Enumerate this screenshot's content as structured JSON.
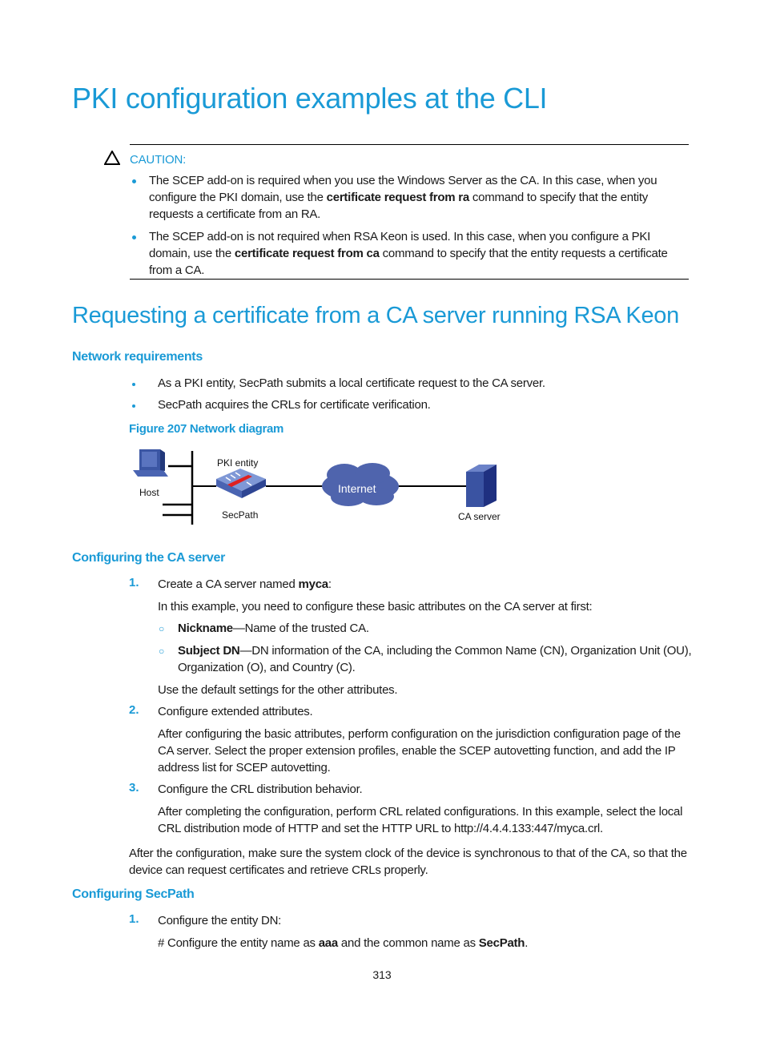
{
  "page": {
    "title": "PKI configuration examples at the CLI",
    "page_number": "313"
  },
  "caution": {
    "icon": "warning-triangle-icon",
    "label": "CAUTION:",
    "items": [
      {
        "pre": "The SCEP add-on is required when you use the Windows Server as the CA. In this case, when you configure the PKI domain, use the ",
        "bold": "certificate request from ra",
        "post": " command to specify that the entity requests a certificate from an RA."
      },
      {
        "pre": "The SCEP add-on is not required when RSA Keon is used. In this case, when you configure a PKI domain, use the ",
        "bold": "certificate request from ca",
        "post": " command to specify that the entity requests a certificate from a CA."
      }
    ]
  },
  "section": {
    "title": "Requesting a certificate from a CA server running RSA Keon",
    "network_requirements": {
      "heading": "Network requirements",
      "bullets": [
        "As a PKI entity, SecPath submits a local certificate request to the CA server.",
        "SecPath acquires the CRLs for certificate verification."
      ],
      "figure_caption": "Figure 207 Network diagram",
      "diagram": {
        "host_label": "Host",
        "pki_entity_label": "PKI entity",
        "secpath_label": "SecPath",
        "internet_label": "Internet",
        "ca_server_label": "CA server"
      }
    },
    "configuring_ca": {
      "heading": "Configuring the CA server",
      "steps": [
        {
          "num": "1.",
          "text_pre": "Create a CA server named ",
          "text_bold": "myca",
          "text_post": ":",
          "body": "In this example, you need to configure these basic attributes on the CA server at first:",
          "sub": [
            {
              "bold": "Nickname",
              "text": "—Name of the trusted CA."
            },
            {
              "bold": "Subject DN",
              "text": "—DN information of the CA, including the Common Name (CN), Organization Unit (OU), Organization (O), and Country (C)."
            }
          ],
          "after": "Use the default settings for the other attributes."
        },
        {
          "num": "2.",
          "text": "Configure extended attributes.",
          "body": "After configuring the basic attributes, perform configuration on the jurisdiction configuration page of the CA server. Select the proper extension profiles, enable the SCEP autovetting function, and add the IP address list for SCEP autovetting."
        },
        {
          "num": "3.",
          "text": "Configure the CRL distribution behavior.",
          "body": "After completing the configuration, perform CRL related configurations. In this example, select the local CRL distribution mode of HTTP and set the HTTP URL to http://4.4.4.133:447/myca.crl."
        }
      ],
      "closing": "After the configuration, make sure the system clock of the device is synchronous to that of the CA, so that the device can request certificates and retrieve CRLs properly."
    },
    "configuring_secpath": {
      "heading": "Configuring SecPath",
      "steps": [
        {
          "num": "1.",
          "text": "Configure the entity DN:",
          "body_pre": "# Configure the entity name as ",
          "body_bold1": "aaa",
          "body_mid": " and the common name as ",
          "body_bold2": "SecPath",
          "body_post": "."
        }
      ]
    }
  }
}
